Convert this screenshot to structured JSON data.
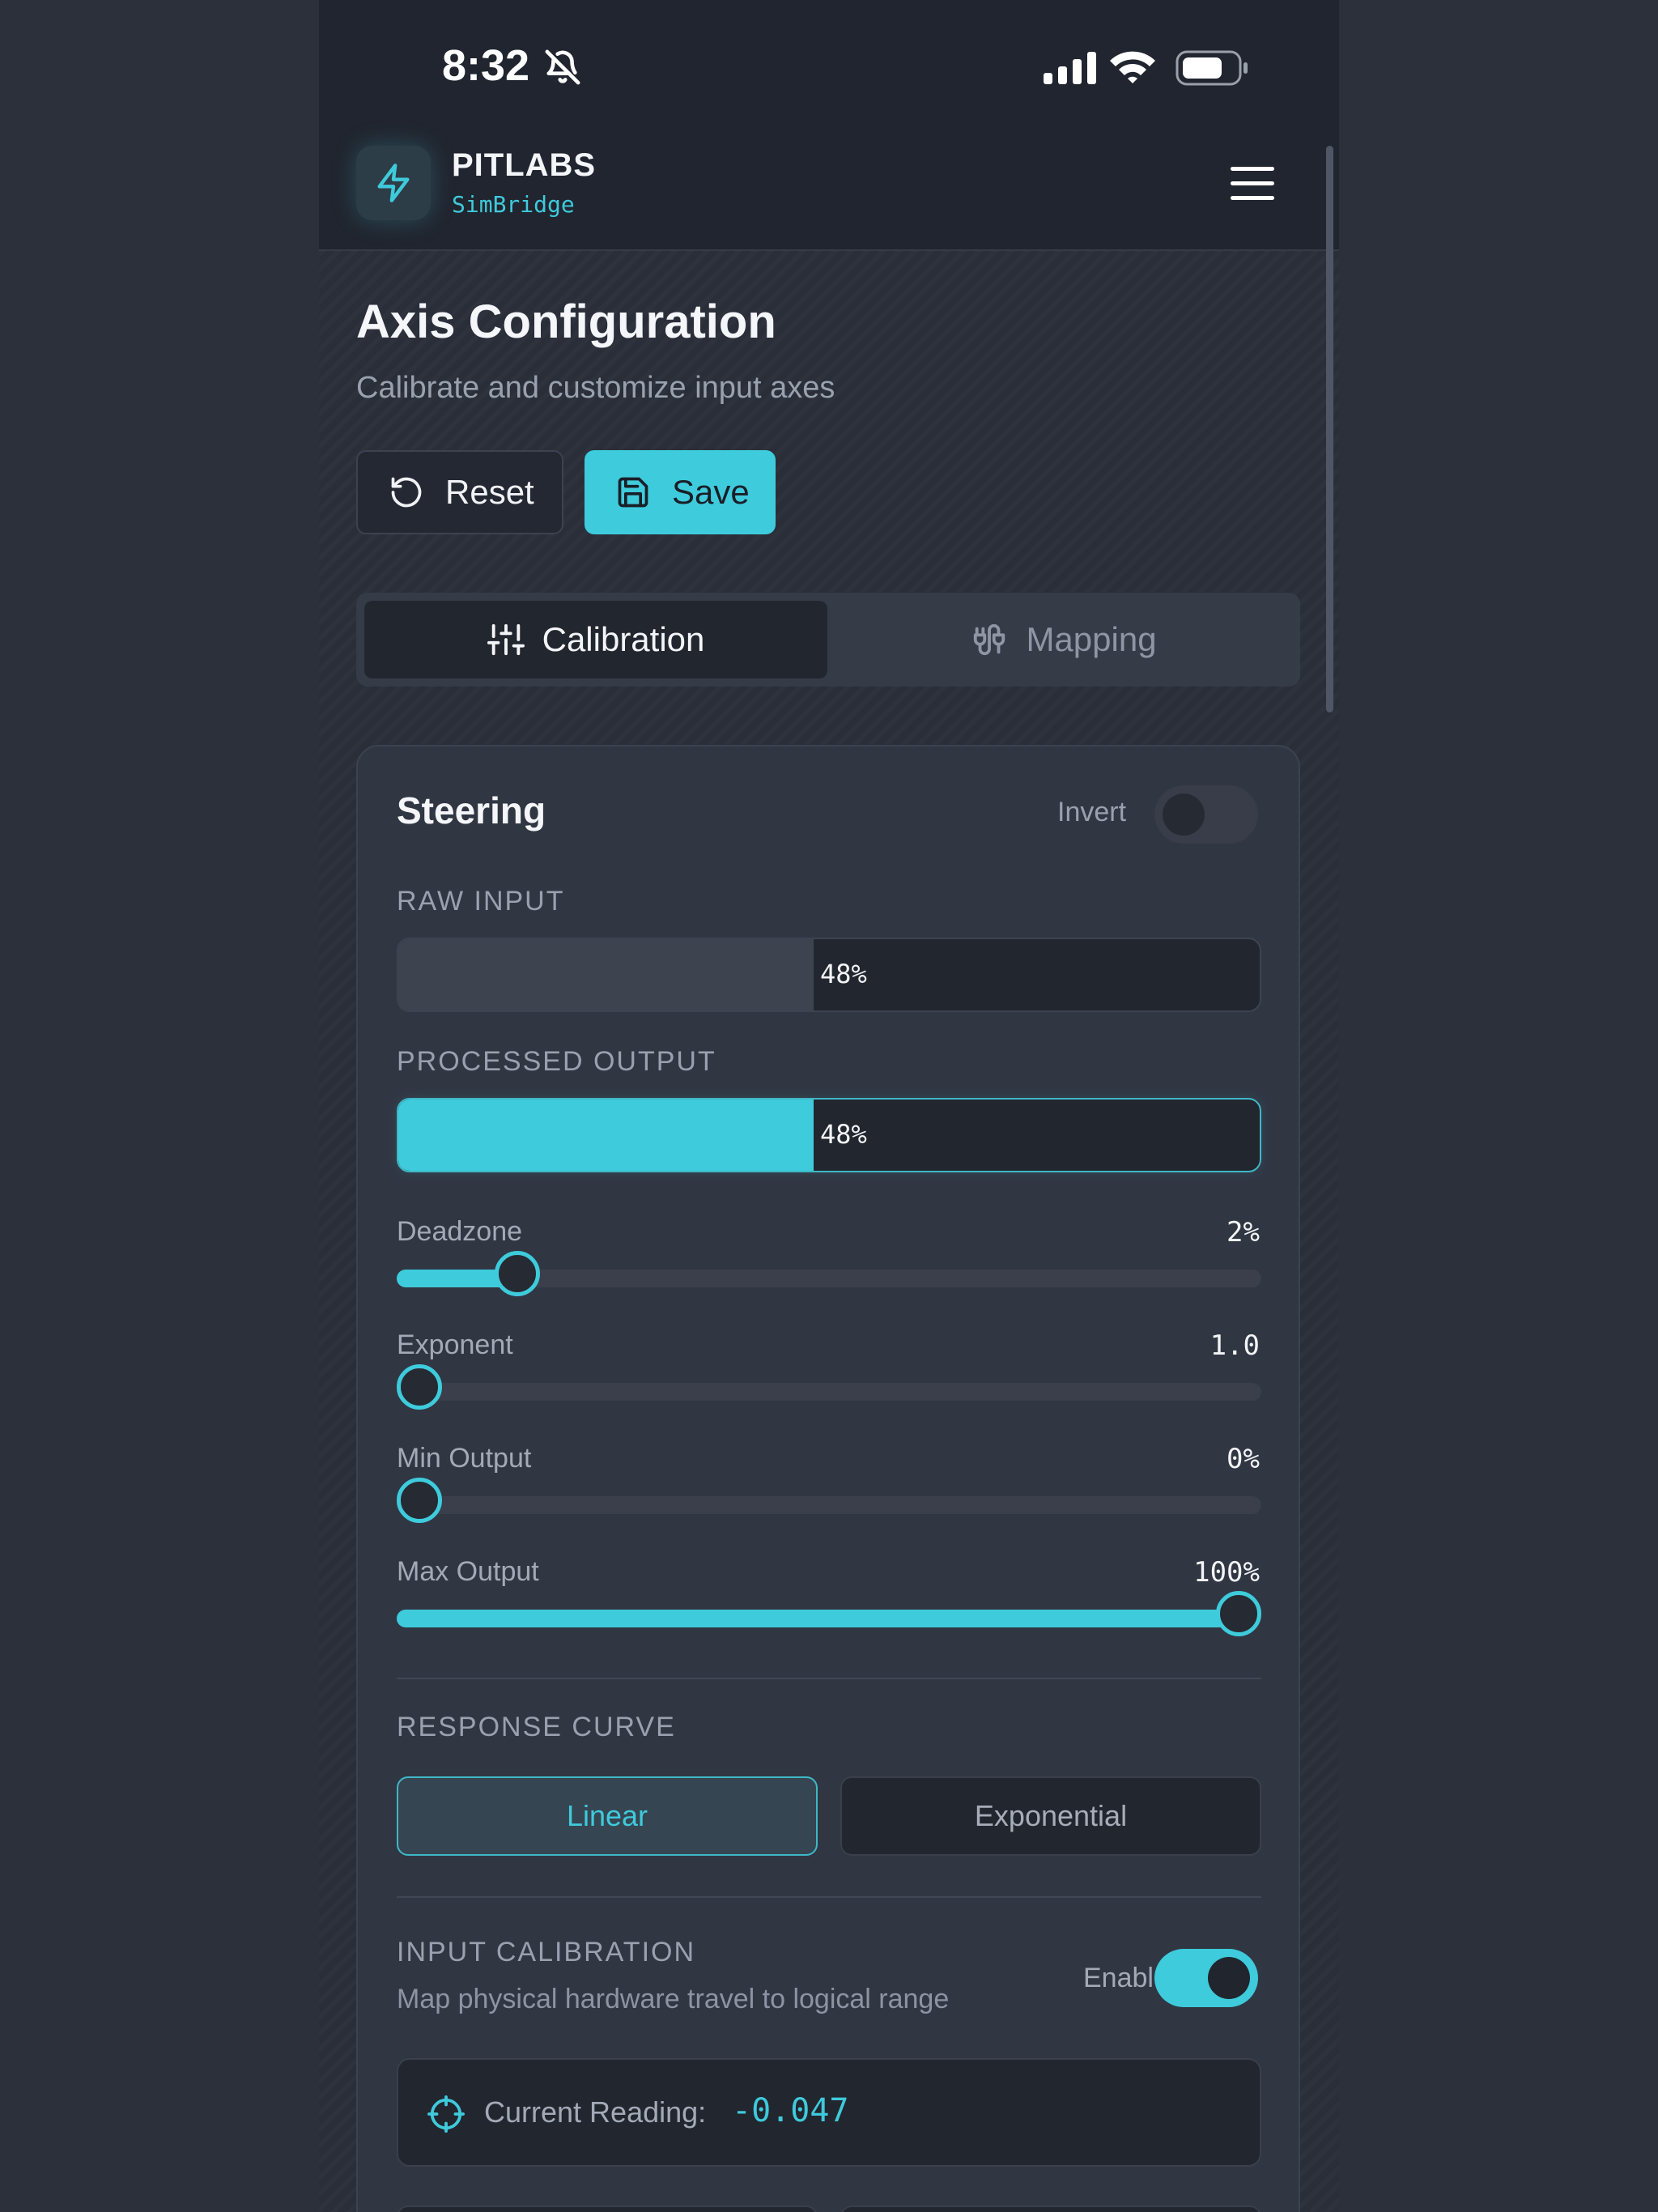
{
  "status_bar": {
    "time": "8:32"
  },
  "header": {
    "brand": "PITLABS",
    "product": "SimBridge"
  },
  "page": {
    "title": "Axis Configuration",
    "subtitle": "Calibrate and customize input axes",
    "reset_label": "Reset",
    "save_label": "Save"
  },
  "tabs": [
    {
      "label": "Calibration",
      "active": true
    },
    {
      "label": "Mapping",
      "active": false
    }
  ],
  "axis": {
    "name": "Steering",
    "invert_label": "Invert",
    "invert": false,
    "raw_label": "RAW INPUT",
    "raw_value": "48%",
    "raw_fraction": 0.48,
    "processed_label": "PROCESSED OUTPUT",
    "processed_value": "48%",
    "processed_fraction": 0.48,
    "sliders": [
      {
        "label": "Deadzone",
        "value": "2%",
        "fraction": 0.12
      },
      {
        "label": "Exponent",
        "value": "1.0",
        "fraction": 0.0
      },
      {
        "label": "Min Output",
        "value": "0%",
        "fraction": 0.0
      },
      {
        "label": "Max Output",
        "value": "100%",
        "fraction": 1.0
      }
    ],
    "curve_label": "RESPONSE CURVE",
    "curve_options": [
      "Linear",
      "Exponential"
    ],
    "curve_selected": "Linear",
    "calibration_label": "INPUT CALIBRATION",
    "calibration_desc": "Map physical hardware travel to logical range",
    "enable_label": "Enable",
    "calibration_enabled": true,
    "reading_label": "Current Reading:",
    "reading_value": "-0.047"
  },
  "colors": {
    "accent": "#3ecbdc",
    "background": "#2a2e39",
    "card": "#313643",
    "header": "#21252f"
  },
  "icons": {
    "logo": "lightning-bolt-icon",
    "menu": "hamburger-menu-icon",
    "reset": "rotate-ccw-icon",
    "save": "floppy-disk-icon",
    "calibration_tab": "sliders-icon",
    "mapping_tab": "cable-plug-icon",
    "reading": "crosshair-icon"
  }
}
